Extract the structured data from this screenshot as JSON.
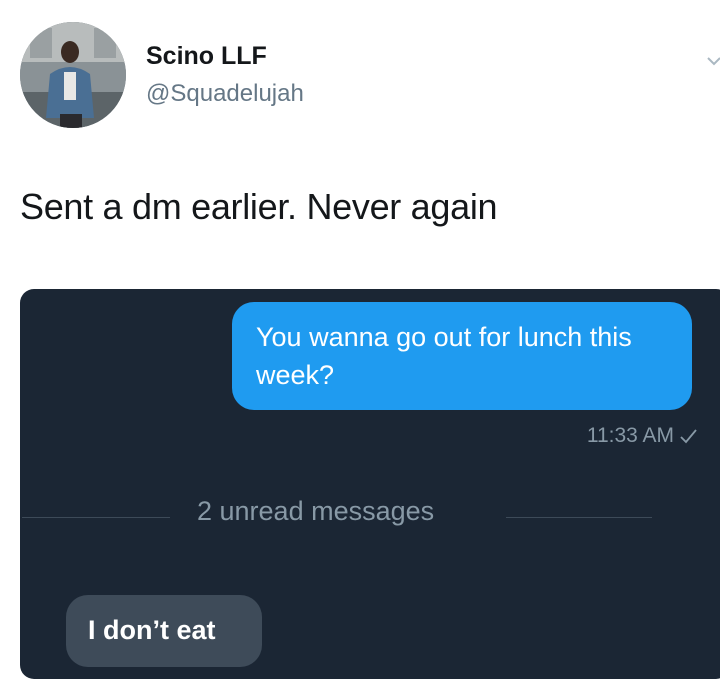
{
  "tweet": {
    "author_name": "Scino LLF",
    "author_handle": "@Squadelujah",
    "text": "Sent a dm earlier. Never again"
  },
  "icons": {
    "avatar": "profile-photo",
    "caret": "chevron-down-icon",
    "read_receipt": "check-icon"
  },
  "dm": {
    "outgoing_message": "You wanna go out for lunch this week?",
    "outgoing_time": "11:33 AM",
    "unread_separator": "2 unread messages",
    "incoming_message": "I don’t eat"
  },
  "colors": {
    "dm_background": "#1b2634",
    "outgoing_bubble": "#1f9bf0",
    "incoming_bubble": "#3e4b59",
    "muted_text": "#8899a6"
  }
}
